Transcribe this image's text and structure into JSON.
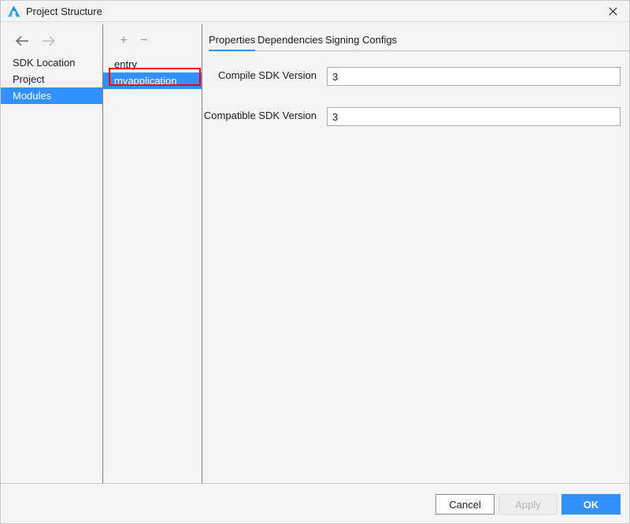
{
  "window": {
    "title": "Project Structure",
    "icon": "deveco-triangle-icon",
    "close_label": "✕",
    "accent_color": "#3390ff",
    "annotation_color": "#ff0000"
  },
  "sidebar": {
    "nav": {
      "back_icon": "arrow-left-icon",
      "forward_icon": "arrow-right-icon",
      "back_enabled": true,
      "forward_enabled": false
    },
    "items": [
      {
        "label": "SDK Location",
        "selected": false
      },
      {
        "label": "Project",
        "selected": false
      },
      {
        "label": "Modules",
        "selected": true
      }
    ]
  },
  "modules_panel": {
    "toolbar": {
      "add_label": "+",
      "add_icon": "plus-icon",
      "remove_label": "−",
      "remove_icon": "minus-icon"
    },
    "items": [
      {
        "label": "entry",
        "selected": false,
        "annotated": false
      },
      {
        "label": "myapplication",
        "selected": true,
        "annotated": true
      }
    ]
  },
  "content": {
    "tabs": [
      {
        "label": "Properties",
        "active": true
      },
      {
        "label": "Dependencies",
        "active": false
      },
      {
        "label": "Signing Configs",
        "active": false
      }
    ],
    "fields": [
      {
        "label": "Compile SDK Version",
        "value": "3",
        "placeholder": ""
      },
      {
        "label": "Compatible SDK Version",
        "value": "3",
        "placeholder": ""
      }
    ]
  },
  "footer": {
    "cancel_label": "Cancel",
    "apply_label": "Apply",
    "apply_enabled": false,
    "ok_label": "OK"
  }
}
